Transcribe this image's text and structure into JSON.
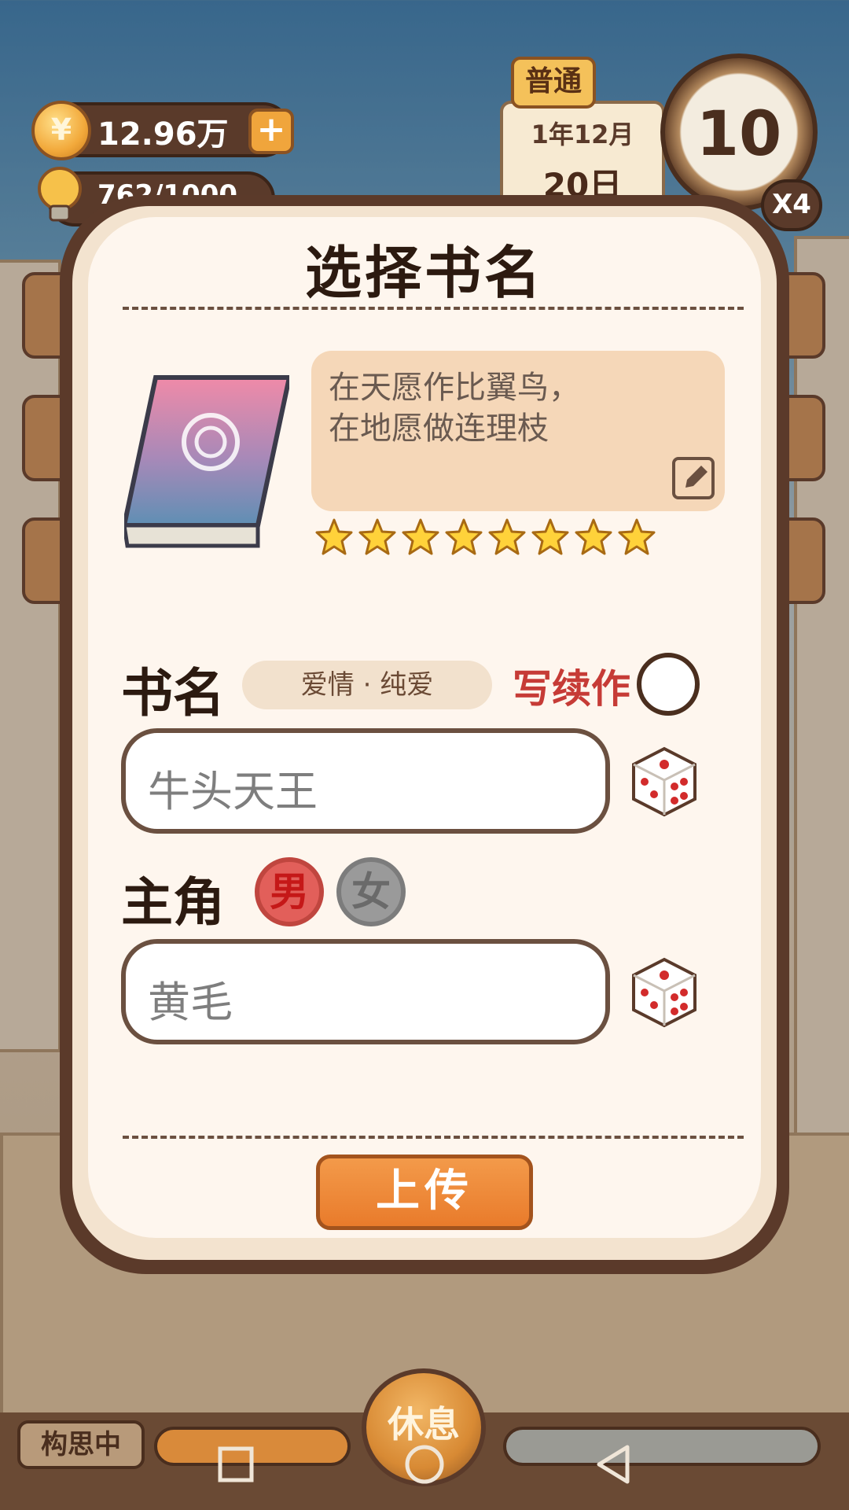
{
  "hud": {
    "money": "12.96万",
    "money_icon_glyph": "¥",
    "energy": "762/1000",
    "date_tag": "普通",
    "date_month": "1年12月",
    "date_day": "20日",
    "clock_value": "10",
    "speed": "X4"
  },
  "dialog": {
    "title": "选择书名",
    "quote_line1": "在天愿作比翼鸟，",
    "quote_line2": "在地愿做连理枝",
    "stars": 8,
    "book_name_label": "书名",
    "genre": "爱情 · 纯爱",
    "sequel_label": "写续作",
    "book_name_value": "牛头天王",
    "protagonist_label": "主角",
    "gender_male": "男",
    "gender_female": "女",
    "protagonist_value": "黄毛",
    "upload_label": "上传"
  },
  "bottom": {
    "status": "构思中",
    "rest_label": "休息"
  },
  "icons": [
    "coin-icon",
    "bulb-icon",
    "plus-icon",
    "clock-icon",
    "book-icon",
    "edit-icon",
    "star-icon",
    "dice-icon",
    "checkbox-icon",
    "nav-square-icon",
    "nav-circle-icon",
    "nav-back-icon"
  ],
  "colors": {
    "accent": "#e97b2b",
    "sequel": "#c63b36",
    "frame": "#5b3a2a",
    "male": "#e25f5a",
    "female": "#9a9a9a"
  }
}
